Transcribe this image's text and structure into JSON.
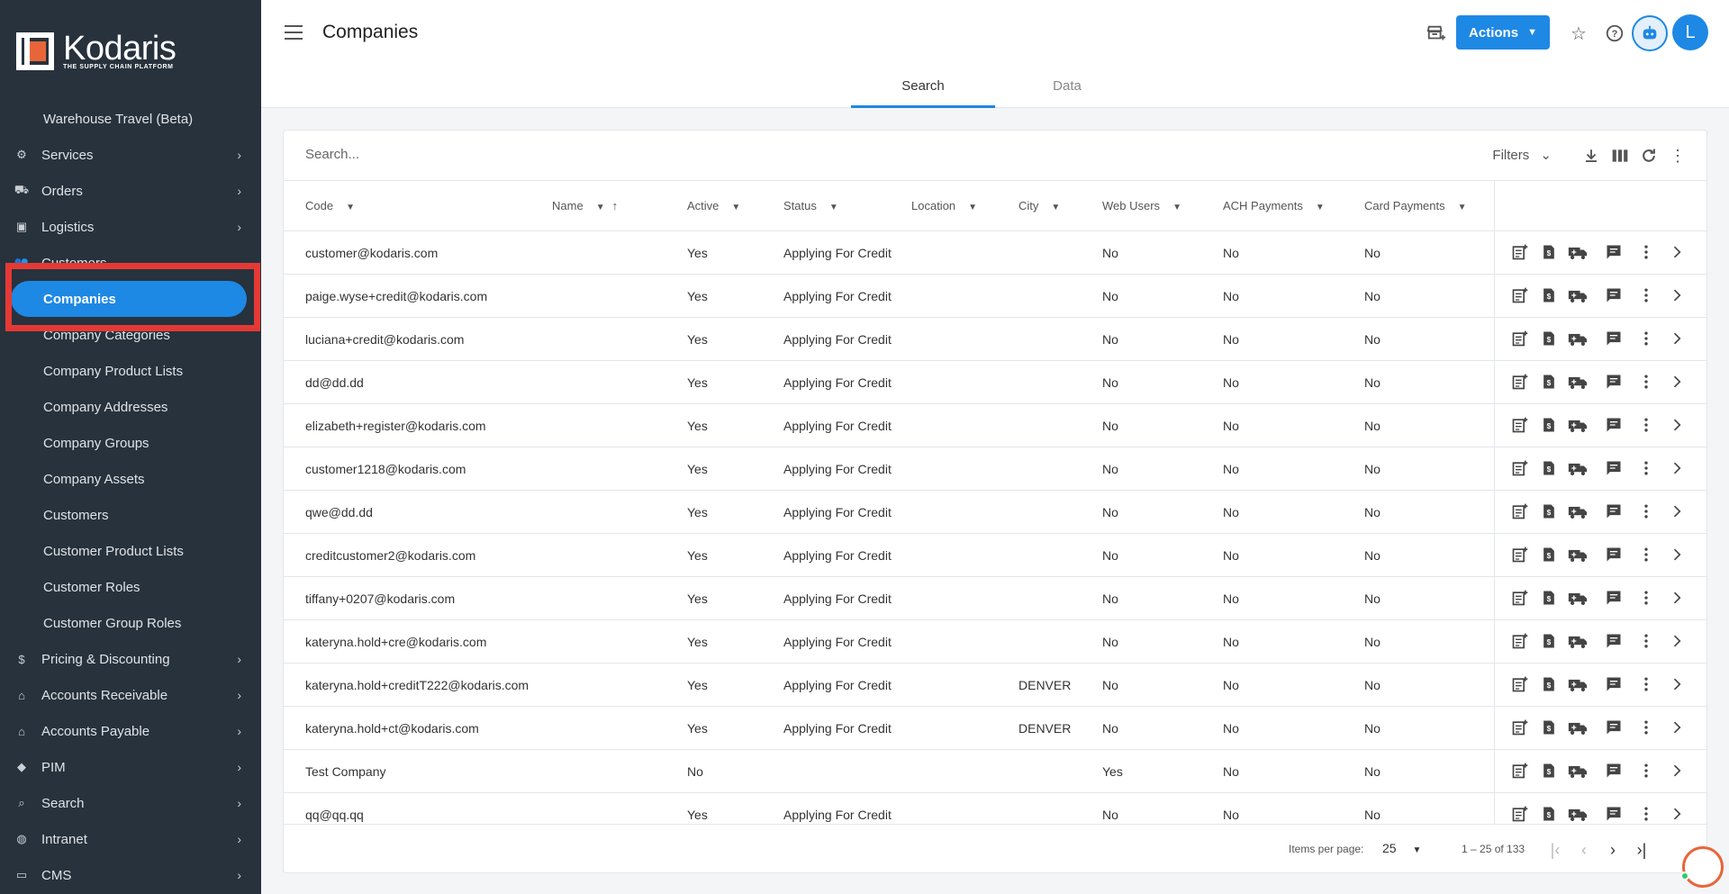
{
  "app": {
    "logo_name": "Kodaris",
    "logo_tagline": "THE SUPPLY CHAIN PLATFORM"
  },
  "sidebar": {
    "items": [
      {
        "label": "Warehouse Travel (Beta)",
        "type": "sub"
      },
      {
        "label": "Services",
        "type": "section",
        "icon": "gears-icon"
      },
      {
        "label": "Orders",
        "type": "section",
        "icon": "truck-icon"
      },
      {
        "label": "Logistics",
        "type": "section",
        "icon": "logistics-icon"
      },
      {
        "label": "Customers",
        "type": "section-open",
        "icon": "people-icon"
      },
      {
        "label": "Companies",
        "type": "active"
      },
      {
        "label": "Company Categories",
        "type": "sub"
      },
      {
        "label": "Company Product Lists",
        "type": "sub"
      },
      {
        "label": "Company Addresses",
        "type": "sub"
      },
      {
        "label": "Company Groups",
        "type": "sub"
      },
      {
        "label": "Company Assets",
        "type": "sub"
      },
      {
        "label": "Customers",
        "type": "sub"
      },
      {
        "label": "Customer Product Lists",
        "type": "sub"
      },
      {
        "label": "Customer Roles",
        "type": "sub"
      },
      {
        "label": "Customer Group Roles",
        "type": "sub"
      },
      {
        "label": "Pricing & Discounting",
        "type": "section",
        "icon": "dollar-icon"
      },
      {
        "label": "Accounts Receivable",
        "type": "section",
        "icon": "bank-icon"
      },
      {
        "label": "Accounts Payable",
        "type": "section",
        "icon": "bank-icon"
      },
      {
        "label": "PIM",
        "type": "section",
        "icon": "tag-icon"
      },
      {
        "label": "Search",
        "type": "section",
        "icon": "search-icon"
      },
      {
        "label": "Intranet",
        "type": "section",
        "icon": "globe-icon"
      },
      {
        "label": "CMS",
        "type": "section",
        "icon": "cms-icon"
      }
    ]
  },
  "header": {
    "title": "Companies",
    "actions_label": "Actions",
    "avatar_initial": "L"
  },
  "tabs": [
    {
      "label": "Search",
      "active": true
    },
    {
      "label": "Data",
      "active": false
    }
  ],
  "search": {
    "placeholder": "Search...",
    "filters_label": "Filters"
  },
  "table": {
    "columns": [
      "Code",
      "Name",
      "Active",
      "Status",
      "Location",
      "City",
      "Web Users",
      "ACH Payments",
      "Card Payments"
    ],
    "sorted_column": "Name",
    "rows": [
      {
        "code": "customer@kodaris.com",
        "name": "",
        "active": "Yes",
        "status": "Applying For Credit",
        "location": "",
        "city": "",
        "web_users": "No",
        "ach": "No",
        "card": "No"
      },
      {
        "code": "paige.wyse+credit@kodaris.com",
        "name": "",
        "active": "Yes",
        "status": "Applying For Credit",
        "location": "",
        "city": "",
        "web_users": "No",
        "ach": "No",
        "card": "No"
      },
      {
        "code": "luciana+credit@kodaris.com",
        "name": "",
        "active": "Yes",
        "status": "Applying For Credit",
        "location": "",
        "city": "",
        "web_users": "No",
        "ach": "No",
        "card": "No"
      },
      {
        "code": "dd@dd.dd",
        "name": "",
        "active": "Yes",
        "status": "Applying For Credit",
        "location": "",
        "city": "",
        "web_users": "No",
        "ach": "No",
        "card": "No"
      },
      {
        "code": "elizabeth+register@kodaris.com",
        "name": "",
        "active": "Yes",
        "status": "Applying For Credit",
        "location": "",
        "city": "",
        "web_users": "No",
        "ach": "No",
        "card": "No"
      },
      {
        "code": "customer1218@kodaris.com",
        "name": "",
        "active": "Yes",
        "status": "Applying For Credit",
        "location": "",
        "city": "",
        "web_users": "No",
        "ach": "No",
        "card": "No"
      },
      {
        "code": "qwe@dd.dd",
        "name": "",
        "active": "Yes",
        "status": "Applying For Credit",
        "location": "",
        "city": "",
        "web_users": "No",
        "ach": "No",
        "card": "No"
      },
      {
        "code": "creditcustomer2@kodaris.com",
        "name": "",
        "active": "Yes",
        "status": "Applying For Credit",
        "location": "",
        "city": "",
        "web_users": "No",
        "ach": "No",
        "card": "No"
      },
      {
        "code": "tiffany+0207@kodaris.com",
        "name": "",
        "active": "Yes",
        "status": "Applying For Credit",
        "location": "",
        "city": "",
        "web_users": "No",
        "ach": "No",
        "card": "No"
      },
      {
        "code": "kateryna.hold+cre@kodaris.com",
        "name": "",
        "active": "Yes",
        "status": "Applying For Credit",
        "location": "",
        "city": "",
        "web_users": "No",
        "ach": "No",
        "card": "No"
      },
      {
        "code": "kateryna.hold+creditT222@kodaris.com",
        "name": "",
        "active": "Yes",
        "status": "Applying For Credit",
        "location": "",
        "city": "DENVER",
        "web_users": "No",
        "ach": "No",
        "card": "No"
      },
      {
        "code": "kateryna.hold+ct@kodaris.com",
        "name": "",
        "active": "Yes",
        "status": "Applying For Credit",
        "location": "",
        "city": "DENVER",
        "web_users": "No",
        "ach": "No",
        "card": "No"
      },
      {
        "code": "Test Company",
        "name": "",
        "active": "No",
        "status": "",
        "location": "",
        "city": "",
        "web_users": "Yes",
        "ach": "No",
        "card": "No"
      },
      {
        "code": "qq@qq.qq",
        "name": "",
        "active": "Yes",
        "status": "Applying For Credit",
        "location": "",
        "city": "",
        "web_users": "No",
        "ach": "No",
        "card": "No"
      }
    ]
  },
  "pagination": {
    "items_per_page_label": "Items per page:",
    "items_per_page": "25",
    "range_label": "1 – 25 of 133"
  },
  "colors": {
    "accent": "#1e88e5",
    "sidebar_bg": "#27323d",
    "highlight": "#e53935"
  }
}
